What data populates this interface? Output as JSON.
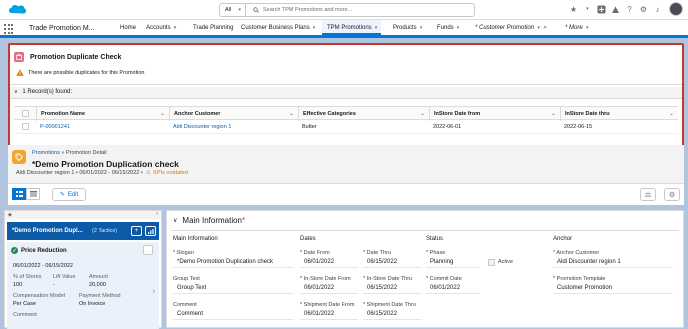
{
  "global_header": {
    "search_scope": "All",
    "search_placeholder": "Search TPM Promotions and more..."
  },
  "nav": {
    "app_name": "Trade Promotion M...",
    "items": [
      {
        "label": "Home"
      },
      {
        "label": "Accounts"
      },
      {
        "label": "Trade Planning"
      },
      {
        "label": "Customer Business Plans"
      },
      {
        "label": "TPM Promotions"
      },
      {
        "label": "Products"
      },
      {
        "label": "Funds"
      },
      {
        "label": "* Customer Promotion"
      },
      {
        "label": "* More"
      }
    ]
  },
  "duplicate_check": {
    "title": "Promotion Duplicate Check",
    "warning": "There are possible duplicates for this Promotion",
    "records_found": "1 Record(s) found:",
    "columns": [
      "Promotion Name",
      "Anchor Customer",
      "Effective Categories",
      "InStore Date from",
      "InStore Date thru"
    ],
    "rows": [
      {
        "promotion_name": "P-00001241",
        "anchor_customer": "Aldi Discounter region 1",
        "effective_categories": "Butter",
        "instore_from": "2022-06-01",
        "instore_thru": "2022-06-15"
      }
    ]
  },
  "record_header": {
    "breadcrumb_root": "Promotions",
    "breadcrumb_sep": "»",
    "breadcrumb_leaf": "Promotion Detail",
    "title": "*Demo Promotion Duplication check",
    "subline": "Aldi Discounter region 1 • 06/01/2022 - 06/15/2022 •",
    "kpi_status": "KPIs outdated",
    "edit_label": "Edit"
  },
  "tactic_panel": {
    "tactic_name": "*Demo Promotion Dupl...",
    "tactic_count": "(2 Tactics)",
    "tactic_type": "Price Reduction",
    "date_range": "06/01/2022 - 06/15/2022",
    "labels": {
      "pct_stores": "% of Stores",
      "lift_value": "Lift Value",
      "amount": "Amount",
      "comp_model": "Compensation Model",
      "payment_method": "Payment Method",
      "comment": "Comment"
    },
    "values": {
      "pct_stores": "100",
      "lift_value": "-",
      "amount": "20,000",
      "comp_model": "Per Case",
      "payment_method": "On Invoice"
    }
  },
  "main_information": {
    "title": "Main Information",
    "required_mark": "*",
    "columns": {
      "main": "Main Information",
      "dates": "Dates",
      "status": "Status",
      "anchor": "Anchor"
    },
    "fields": {
      "slogan_label": "* Slogan",
      "slogan": "*Demo Promotion Duplication check",
      "group_text_label": "Group Text",
      "group_text": "Group Text",
      "comment_label": "Comment",
      "comment": "Comment",
      "date_from_label": "* Date From",
      "date_from": "06/01/2022",
      "date_thru_label": "* Date Thru",
      "date_thru": "06/15/2022",
      "instore_from_label": "* In-Store Date From",
      "instore_from": "06/01/2022",
      "instore_thru_label": "* In-Store Date Thru",
      "instore_thru": "06/15/2022",
      "shipment_from_label": "* Shipment Date From",
      "shipment_from": "06/01/2022",
      "shipment_thru_label": "* Shipment Date Thru",
      "shipment_thru": "06/15/2022",
      "phase_label": "* Phase",
      "phase": "Planning",
      "active_label": "Active",
      "commit_date_label": "* Commit Date",
      "commit_date": "06/01/2022",
      "anchor_customer_label": "* Anchor Customer",
      "anchor_customer": "Aldi Discounter region 1",
      "promotion_template_label": "* Promotion Template",
      "promotion_template": "Customer Promotion"
    }
  },
  "colors": {
    "brand": "#0176d3",
    "highlight_border": "#c23934",
    "tactic_blue": "#0d5aa7",
    "warning": "#dd7a01"
  }
}
